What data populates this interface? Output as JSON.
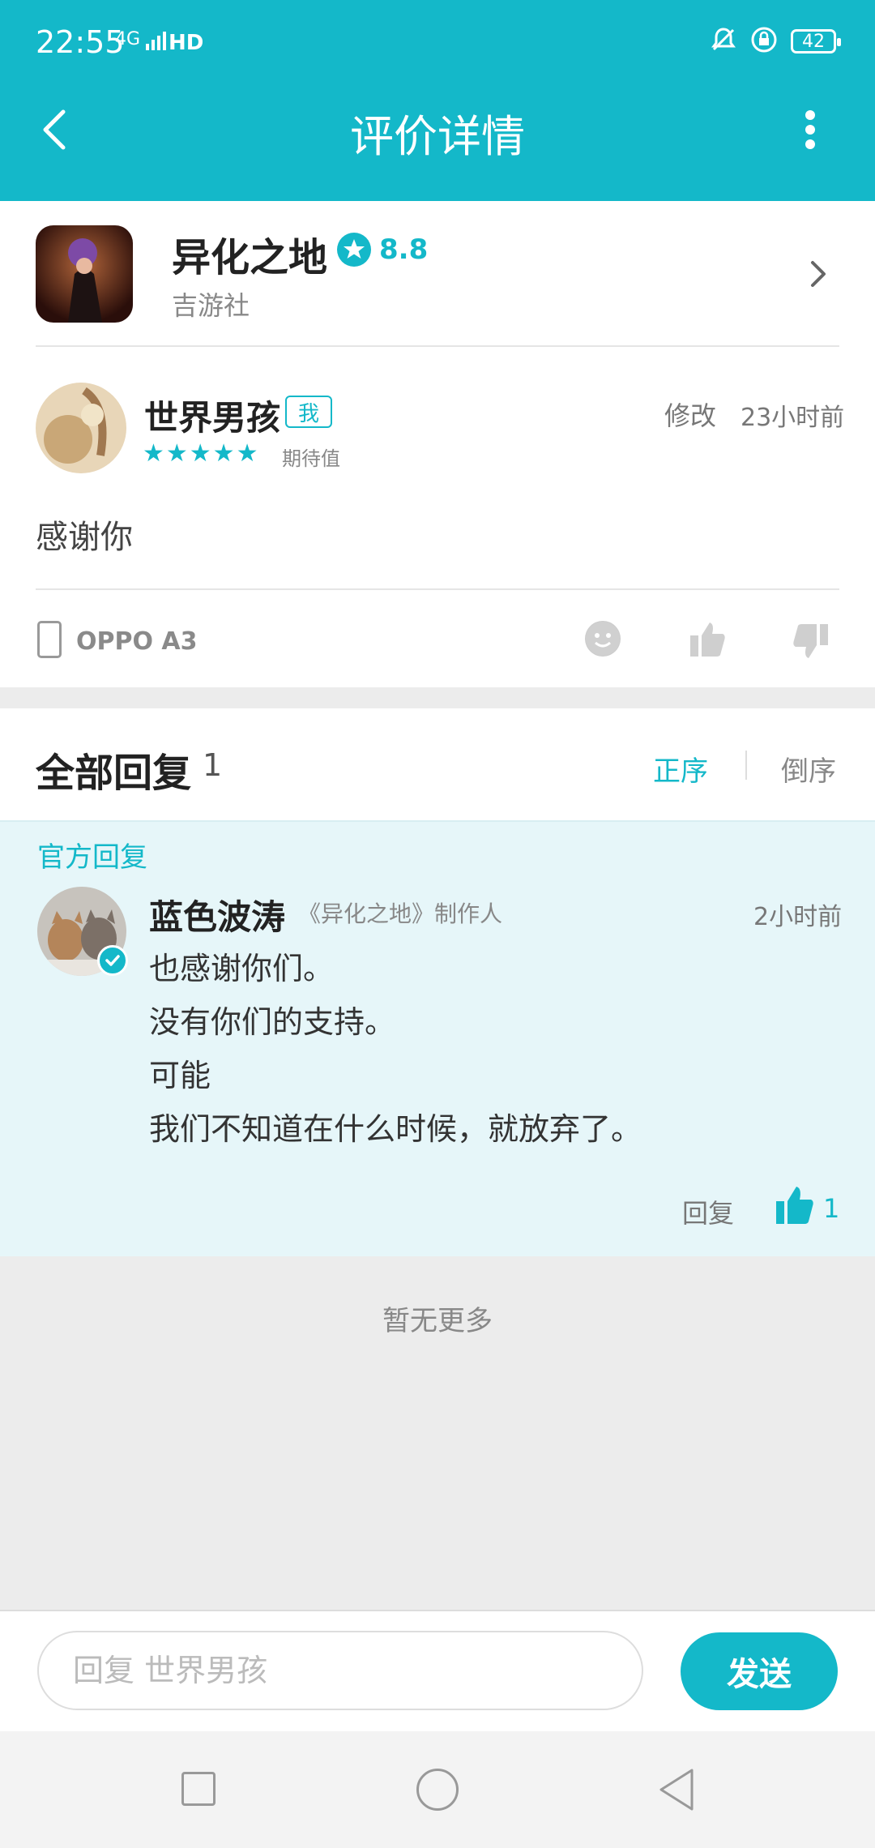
{
  "status_bar": {
    "time": "22:55",
    "network": "4G",
    "hd": "HD",
    "battery": "42"
  },
  "header": {
    "title": "评价详情"
  },
  "app": {
    "name": "异化之地",
    "rating": "8.8",
    "publisher": "吉游社"
  },
  "review": {
    "username": "世界男孩",
    "me_badge": "我",
    "stars": "★★★★★",
    "rating_label": "期待值",
    "edit": "修改",
    "time": "23小时前",
    "content": "感谢你",
    "device": "OPPO A3"
  },
  "replies": {
    "title": "全部回复",
    "count": "1",
    "sort_asc": "正序",
    "sort_desc": "倒序",
    "official_label": "官方回复",
    "items": [
      {
        "name": "蓝色波涛",
        "role": "《异化之地》制作人",
        "time": "2小时前",
        "lines": [
          "也感谢你们。",
          "没有你们的支持。",
          "可能",
          "我们不知道在什么时候，就放弃了。"
        ],
        "reply_label": "回复",
        "likes": "1"
      }
    ],
    "no_more": "暂无更多"
  },
  "composer": {
    "placeholder": "回复 世界男孩",
    "send": "发送"
  },
  "colors": {
    "accent": "#14b8c9",
    "official_bg": "#e6f6f9"
  }
}
